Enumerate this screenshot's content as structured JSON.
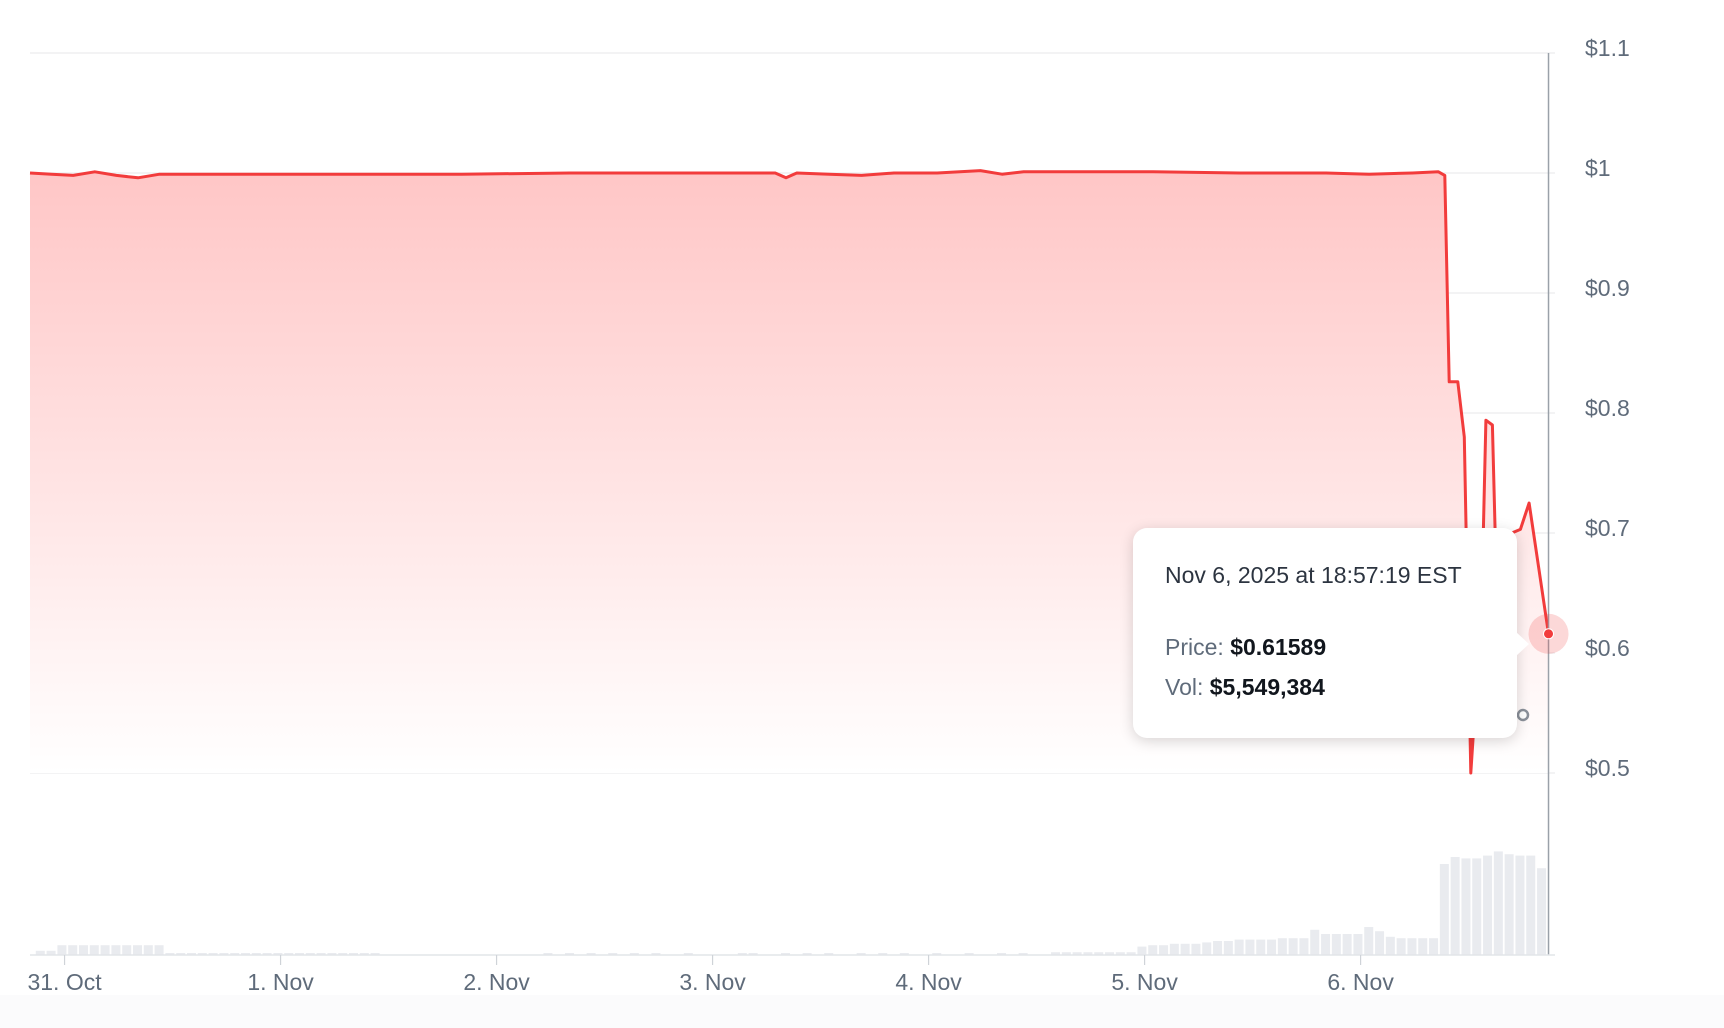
{
  "colors": {
    "line": "#f23c3c",
    "area_top": "#ffc6c6",
    "grid": "#ececee",
    "volume": "#e9ebef",
    "crosshair": "#9aa1a9",
    "tick_text": "#5f6b7a"
  },
  "tooltip": {
    "date": "Nov 6, 2025 at 18:57:19 EST",
    "price_label": "Price:",
    "price_value": "$0.61589",
    "vol_label": "Vol:",
    "vol_value": "$5,549,384"
  },
  "chart_data": {
    "type": "area",
    "title": "",
    "xlabel": "",
    "ylabel": "",
    "ylim": [
      0.5,
      1.1
    ],
    "xlim": [
      0,
      7.06
    ],
    "grid": true,
    "y_axis_position": "right",
    "y_ticks": [
      {
        "value": 1.1,
        "label": "$1.1"
      },
      {
        "value": 1.0,
        "label": "$1"
      },
      {
        "value": 0.9,
        "label": "$0.9"
      },
      {
        "value": 0.8,
        "label": "$0.8"
      },
      {
        "value": 0.7,
        "label": "$0.7"
      },
      {
        "value": 0.6,
        "label": "$0.6"
      },
      {
        "value": 0.5,
        "label": "$0.5"
      }
    ],
    "x_ticks": [
      {
        "value": 0.16,
        "label": "31. Oct"
      },
      {
        "value": 1.16,
        "label": "1. Nov"
      },
      {
        "value": 2.16,
        "label": "2. Nov"
      },
      {
        "value": 3.16,
        "label": "3. Nov"
      },
      {
        "value": 4.16,
        "label": "4. Nov"
      },
      {
        "value": 5.16,
        "label": "5. Nov"
      },
      {
        "value": 6.16,
        "label": "6. Nov"
      }
    ],
    "series": [
      {
        "points": [
          [
            0.0,
            1.0
          ],
          [
            0.1,
            0.999
          ],
          [
            0.2,
            0.998
          ],
          [
            0.3,
            1.001
          ],
          [
            0.4,
            0.998
          ],
          [
            0.5,
            0.996
          ],
          [
            0.6,
            0.999
          ],
          [
            0.8,
            0.999
          ],
          [
            1.0,
            0.999
          ],
          [
            1.5,
            0.999
          ],
          [
            2.0,
            0.999
          ],
          [
            2.5,
            1.0
          ],
          [
            3.0,
            1.0
          ],
          [
            3.45,
            1.0
          ],
          [
            3.5,
            0.996
          ],
          [
            3.55,
            1.0
          ],
          [
            3.7,
            0.999
          ],
          [
            3.85,
            0.998
          ],
          [
            4.0,
            1.0
          ],
          [
            4.2,
            1.0
          ],
          [
            4.4,
            1.002
          ],
          [
            4.5,
            0.999
          ],
          [
            4.6,
            1.001
          ],
          [
            4.8,
            1.001
          ],
          [
            5.2,
            1.001
          ],
          [
            5.6,
            1.0
          ],
          [
            6.0,
            1.0
          ],
          [
            6.2,
            0.999
          ],
          [
            6.4,
            1.0
          ],
          [
            6.52,
            1.001
          ],
          [
            6.55,
            0.998
          ],
          [
            6.57,
            0.826
          ],
          [
            6.61,
            0.826
          ],
          [
            6.64,
            0.78
          ],
          [
            6.67,
            0.5
          ],
          [
            6.72,
            0.638
          ],
          [
            6.74,
            0.794
          ],
          [
            6.77,
            0.79
          ],
          [
            6.79,
            0.65
          ],
          [
            6.81,
            0.56
          ],
          [
            6.86,
            0.7
          ],
          [
            6.9,
            0.703
          ],
          [
            6.94,
            0.725
          ],
          [
            7.03,
            0.616
          ]
        ]
      }
    ],
    "volume": [
      {
        "x": 0.05,
        "v": 3
      },
      {
        "x": 0.1,
        "v": 3
      },
      {
        "x": 0.15,
        "v": 7
      },
      {
        "x": 0.2,
        "v": 7
      },
      {
        "x": 0.25,
        "v": 7
      },
      {
        "x": 0.3,
        "v": 7
      },
      {
        "x": 0.35,
        "v": 7
      },
      {
        "x": 0.4,
        "v": 7
      },
      {
        "x": 0.45,
        "v": 7
      },
      {
        "x": 0.5,
        "v": 7
      },
      {
        "x": 0.55,
        "v": 7
      },
      {
        "x": 0.6,
        "v": 7
      },
      {
        "x": 0.65,
        "v": 1
      },
      {
        "x": 0.7,
        "v": 1
      },
      {
        "x": 0.75,
        "v": 1
      },
      {
        "x": 0.8,
        "v": 1
      },
      {
        "x": 0.85,
        "v": 1
      },
      {
        "x": 0.9,
        "v": 1
      },
      {
        "x": 0.95,
        "v": 1
      },
      {
        "x": 1.0,
        "v": 1
      },
      {
        "x": 1.05,
        "v": 1
      },
      {
        "x": 1.1,
        "v": 1
      },
      {
        "x": 1.15,
        "v": 1
      },
      {
        "x": 1.2,
        "v": 1
      },
      {
        "x": 1.25,
        "v": 1
      },
      {
        "x": 1.3,
        "v": 1
      },
      {
        "x": 1.35,
        "v": 1
      },
      {
        "x": 1.4,
        "v": 1
      },
      {
        "x": 1.45,
        "v": 1
      },
      {
        "x": 1.5,
        "v": 1
      },
      {
        "x": 1.55,
        "v": 1
      },
      {
        "x": 1.6,
        "v": 1
      },
      {
        "x": 2.4,
        "v": 1
      },
      {
        "x": 2.5,
        "v": 1
      },
      {
        "x": 2.6,
        "v": 1
      },
      {
        "x": 2.7,
        "v": 1
      },
      {
        "x": 2.8,
        "v": 1
      },
      {
        "x": 2.9,
        "v": 1
      },
      {
        "x": 3.05,
        "v": 1
      },
      {
        "x": 3.3,
        "v": 1
      },
      {
        "x": 3.35,
        "v": 1
      },
      {
        "x": 3.5,
        "v": 1
      },
      {
        "x": 3.6,
        "v": 1
      },
      {
        "x": 3.7,
        "v": 1
      },
      {
        "x": 3.85,
        "v": 1
      },
      {
        "x": 3.95,
        "v": 1
      },
      {
        "x": 4.05,
        "v": 1
      },
      {
        "x": 4.2,
        "v": 1
      },
      {
        "x": 4.35,
        "v": 1
      },
      {
        "x": 4.5,
        "v": 1
      },
      {
        "x": 4.6,
        "v": 1
      },
      {
        "x": 4.75,
        "v": 2
      },
      {
        "x": 4.8,
        "v": 2
      },
      {
        "x": 4.85,
        "v": 2
      },
      {
        "x": 4.9,
        "v": 2
      },
      {
        "x": 4.95,
        "v": 2
      },
      {
        "x": 5.0,
        "v": 2
      },
      {
        "x": 5.05,
        "v": 2
      },
      {
        "x": 5.1,
        "v": 2
      },
      {
        "x": 5.15,
        "v": 6
      },
      {
        "x": 5.2,
        "v": 7
      },
      {
        "x": 5.25,
        "v": 7
      },
      {
        "x": 5.3,
        "v": 8
      },
      {
        "x": 5.35,
        "v": 8
      },
      {
        "x": 5.4,
        "v": 8
      },
      {
        "x": 5.45,
        "v": 9
      },
      {
        "x": 5.5,
        "v": 10
      },
      {
        "x": 5.55,
        "v": 10
      },
      {
        "x": 5.6,
        "v": 11
      },
      {
        "x": 5.65,
        "v": 11
      },
      {
        "x": 5.7,
        "v": 11
      },
      {
        "x": 5.75,
        "v": 11
      },
      {
        "x": 5.8,
        "v": 12
      },
      {
        "x": 5.85,
        "v": 12
      },
      {
        "x": 5.9,
        "v": 12
      },
      {
        "x": 5.95,
        "v": 18
      },
      {
        "x": 6.0,
        "v": 15
      },
      {
        "x": 6.05,
        "v": 15
      },
      {
        "x": 6.1,
        "v": 15
      },
      {
        "x": 6.15,
        "v": 15
      },
      {
        "x": 6.2,
        "v": 20
      },
      {
        "x": 6.25,
        "v": 17
      },
      {
        "x": 6.3,
        "v": 13
      },
      {
        "x": 6.35,
        "v": 12
      },
      {
        "x": 6.4,
        "v": 12
      },
      {
        "x": 6.45,
        "v": 12
      },
      {
        "x": 6.5,
        "v": 12
      },
      {
        "x": 6.55,
        "v": 65
      },
      {
        "x": 6.6,
        "v": 70
      },
      {
        "x": 6.65,
        "v": 69
      },
      {
        "x": 6.7,
        "v": 69
      },
      {
        "x": 6.75,
        "v": 71
      },
      {
        "x": 6.8,
        "v": 74
      },
      {
        "x": 6.85,
        "v": 72
      },
      {
        "x": 6.9,
        "v": 71
      },
      {
        "x": 6.95,
        "v": 71
      },
      {
        "x": 7.0,
        "v": 62
      }
    ],
    "highlight": {
      "x": 7.03,
      "y": 0.616
    }
  }
}
